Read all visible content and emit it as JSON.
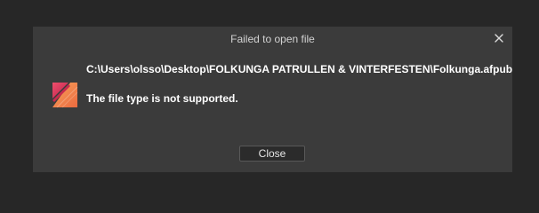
{
  "dialog": {
    "title": "Failed to open file",
    "close_icon": "close-icon",
    "app_icon": "affinity-publisher-icon",
    "file_path": "C:\\Users\\olsso\\Desktop\\FOLKUNGA PATRULLEN & VINTERFESTEN\\Folkunga.afpub",
    "message": "The file type is not supported.",
    "close_button_label": "Close"
  },
  "colors": {
    "background": "#272727",
    "dialog_background": "#3b3b3b",
    "icon_pink": "#e0415f",
    "icon_orange": "#f28c4a"
  }
}
